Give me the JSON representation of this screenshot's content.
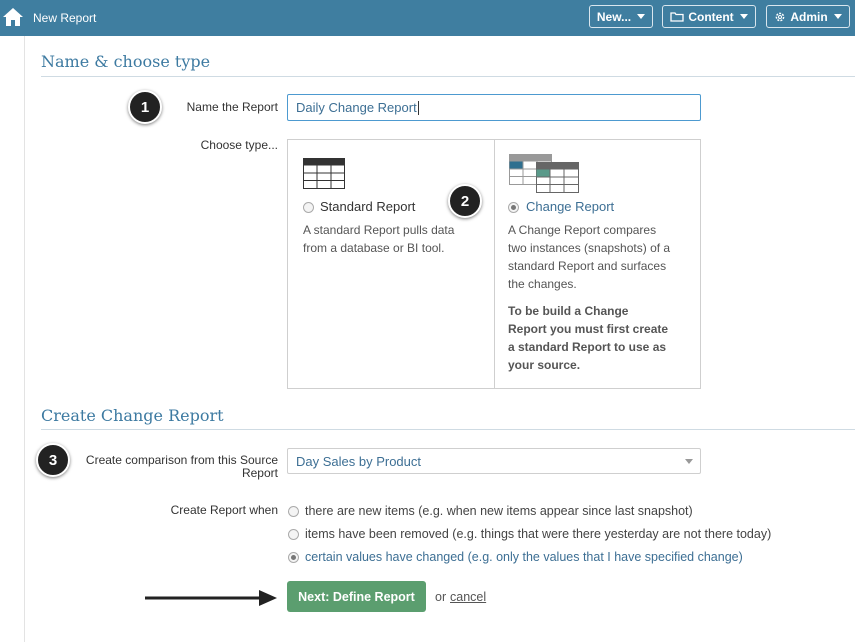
{
  "header": {
    "title": "New Report",
    "new_label": "New...",
    "content_label": "Content",
    "admin_label": "Admin"
  },
  "section1": {
    "title": "Name & choose type",
    "name_label": "Name the Report",
    "name_value": "Daily Change Report",
    "type_label": "Choose type...",
    "badge1": "1",
    "badge2": "2"
  },
  "standard_report": {
    "label": "Standard Report",
    "desc_line1": "A standard Report pulls data",
    "desc_line2": "from a database or BI tool.",
    "selected": false
  },
  "change_report": {
    "label": "Change Report",
    "desc_line1": "A Change Report compares",
    "desc_line2": "two instances (snapshots) of a",
    "desc_line3": "standard Report and surfaces",
    "desc_line4": "the changes.",
    "note_line1": "To be build a Change",
    "note_line2": "Report you must first create",
    "note_line3": "a standard Report to use as",
    "note_line4": "your source.",
    "selected": true
  },
  "section2": {
    "title": "Create Change Report",
    "badge3": "3",
    "source_label_line1": "Create comparison from this Source",
    "source_label_line2": "Report",
    "source_value": "Day Sales by Product",
    "when_label": "Create Report when",
    "options": [
      "there are new items (e.g. when new items appear since last snapshot)",
      "items have been removed (e.g. things that were there yesterday are not there today)",
      "certain values have changed (e.g. only the values that I have specified change)"
    ],
    "selected_option": 2
  },
  "actions": {
    "next_label": "Next: Define Report",
    "or_text": "or",
    "cancel_label": "cancel"
  },
  "colors": {
    "topbar": "#3f7ea0",
    "accent": "#3d7aa1",
    "next_button": "#5b9e6f"
  }
}
